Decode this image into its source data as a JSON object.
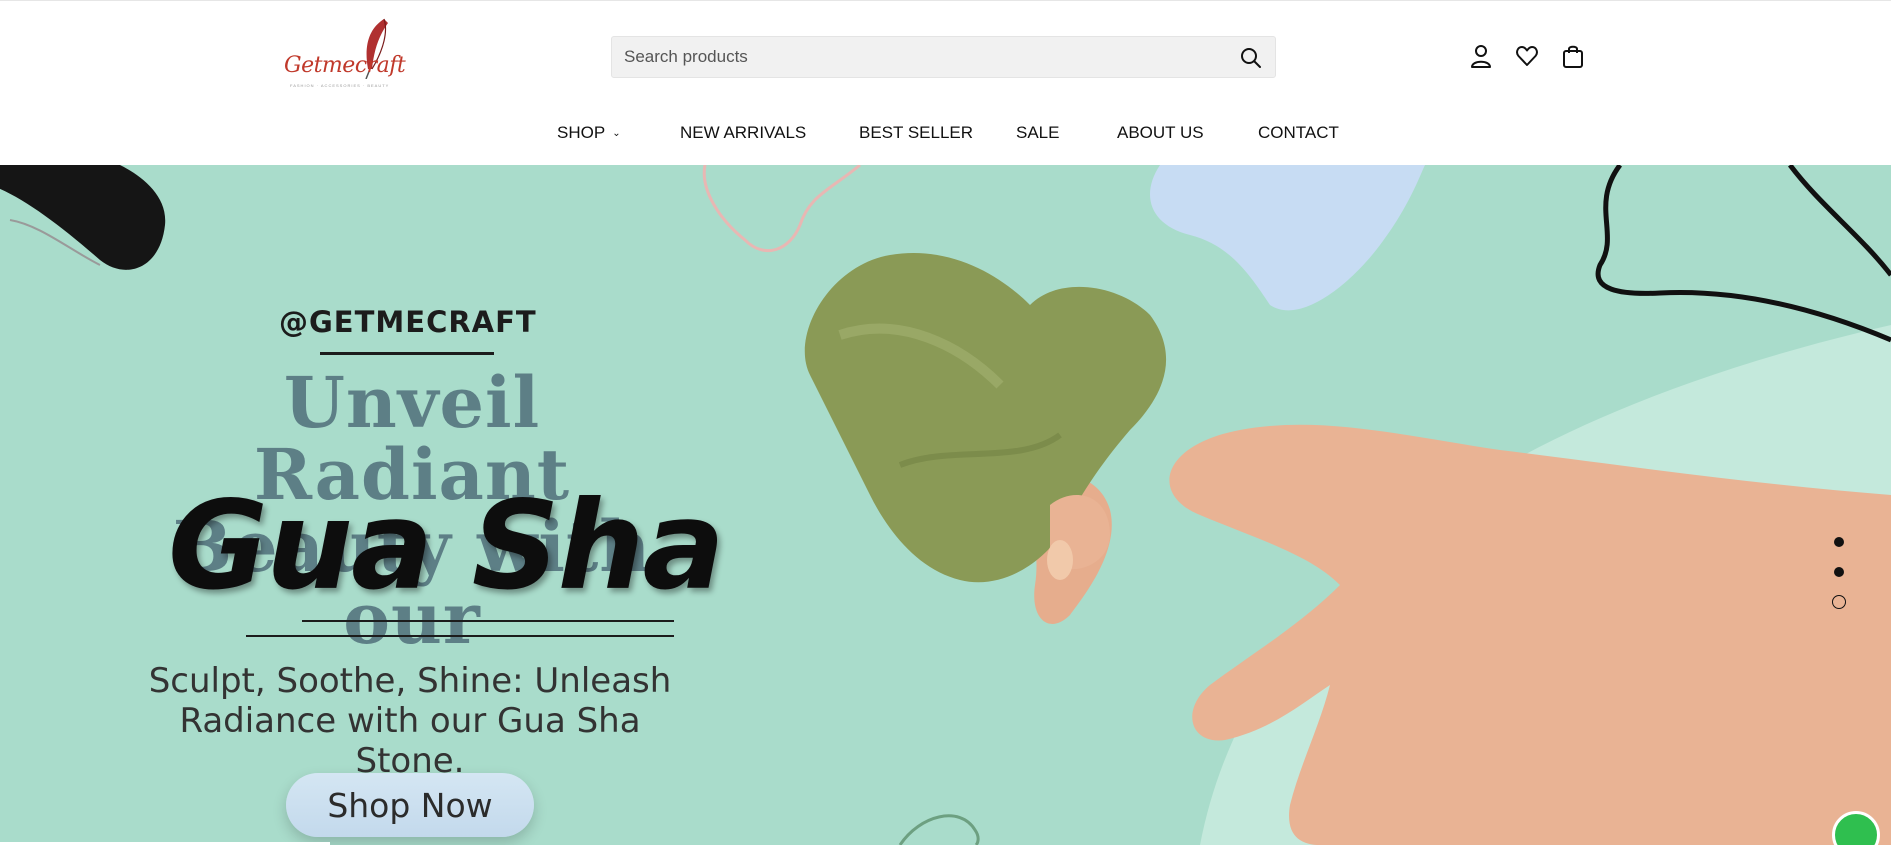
{
  "brand": {
    "logo_text": "Getmecraft",
    "logo_tagline": "FASHION · ACCESSORIES · BEAUTY",
    "accent_color": "#c0392b"
  },
  "search": {
    "placeholder": "Search products",
    "icon": "search-icon"
  },
  "header_icons": [
    {
      "name": "account-icon"
    },
    {
      "name": "wishlist-heart-icon"
    },
    {
      "name": "cart-bag-icon"
    }
  ],
  "nav": {
    "items": [
      {
        "label": "SHOP",
        "has_dropdown": true
      },
      {
        "label": "NEW ARRIVALS"
      },
      {
        "label": "BEST SELLER"
      },
      {
        "label": "SALE"
      },
      {
        "label": "ABOUT US"
      },
      {
        "label": "CONTACT"
      }
    ]
  },
  "hero": {
    "handle": "@GETMECRAFT",
    "headline": "Unveil Radiant Beauty with our",
    "script_title": "Gua Sha",
    "subtext": "Sculpt, Soothe, Shine: Unleash Radiance with our Gua Sha Stone.",
    "cta_label": "Shop Now",
    "background_color": "#a9dccb",
    "slides_total": 3,
    "active_slide": 3
  },
  "whatsapp": {
    "icon": "whatsapp-icon",
    "color": "#2fbf4f"
  }
}
